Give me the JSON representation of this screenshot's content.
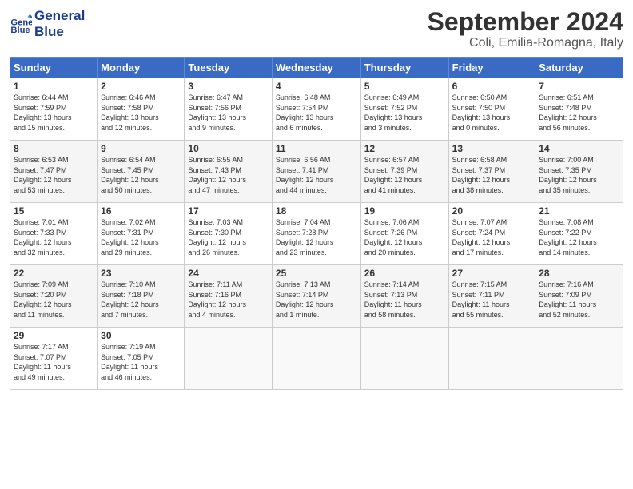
{
  "header": {
    "logo_line1": "General",
    "logo_line2": "Blue",
    "month": "September 2024",
    "location": "Coli, Emilia-Romagna, Italy"
  },
  "columns": [
    "Sunday",
    "Monday",
    "Tuesday",
    "Wednesday",
    "Thursday",
    "Friday",
    "Saturday"
  ],
  "weeks": [
    [
      {
        "day": "1",
        "info": "Sunrise: 6:44 AM\nSunset: 7:59 PM\nDaylight: 13 hours\nand 15 minutes."
      },
      {
        "day": "2",
        "info": "Sunrise: 6:46 AM\nSunset: 7:58 PM\nDaylight: 13 hours\nand 12 minutes."
      },
      {
        "day": "3",
        "info": "Sunrise: 6:47 AM\nSunset: 7:56 PM\nDaylight: 13 hours\nand 9 minutes."
      },
      {
        "day": "4",
        "info": "Sunrise: 6:48 AM\nSunset: 7:54 PM\nDaylight: 13 hours\nand 6 minutes."
      },
      {
        "day": "5",
        "info": "Sunrise: 6:49 AM\nSunset: 7:52 PM\nDaylight: 13 hours\nand 3 minutes."
      },
      {
        "day": "6",
        "info": "Sunrise: 6:50 AM\nSunset: 7:50 PM\nDaylight: 13 hours\nand 0 minutes."
      },
      {
        "day": "7",
        "info": "Sunrise: 6:51 AM\nSunset: 7:48 PM\nDaylight: 12 hours\nand 56 minutes."
      }
    ],
    [
      {
        "day": "8",
        "info": "Sunrise: 6:53 AM\nSunset: 7:47 PM\nDaylight: 12 hours\nand 53 minutes."
      },
      {
        "day": "9",
        "info": "Sunrise: 6:54 AM\nSunset: 7:45 PM\nDaylight: 12 hours\nand 50 minutes."
      },
      {
        "day": "10",
        "info": "Sunrise: 6:55 AM\nSunset: 7:43 PM\nDaylight: 12 hours\nand 47 minutes."
      },
      {
        "day": "11",
        "info": "Sunrise: 6:56 AM\nSunset: 7:41 PM\nDaylight: 12 hours\nand 44 minutes."
      },
      {
        "day": "12",
        "info": "Sunrise: 6:57 AM\nSunset: 7:39 PM\nDaylight: 12 hours\nand 41 minutes."
      },
      {
        "day": "13",
        "info": "Sunrise: 6:58 AM\nSunset: 7:37 PM\nDaylight: 12 hours\nand 38 minutes."
      },
      {
        "day": "14",
        "info": "Sunrise: 7:00 AM\nSunset: 7:35 PM\nDaylight: 12 hours\nand 35 minutes."
      }
    ],
    [
      {
        "day": "15",
        "info": "Sunrise: 7:01 AM\nSunset: 7:33 PM\nDaylight: 12 hours\nand 32 minutes."
      },
      {
        "day": "16",
        "info": "Sunrise: 7:02 AM\nSunset: 7:31 PM\nDaylight: 12 hours\nand 29 minutes."
      },
      {
        "day": "17",
        "info": "Sunrise: 7:03 AM\nSunset: 7:30 PM\nDaylight: 12 hours\nand 26 minutes."
      },
      {
        "day": "18",
        "info": "Sunrise: 7:04 AM\nSunset: 7:28 PM\nDaylight: 12 hours\nand 23 minutes."
      },
      {
        "day": "19",
        "info": "Sunrise: 7:06 AM\nSunset: 7:26 PM\nDaylight: 12 hours\nand 20 minutes."
      },
      {
        "day": "20",
        "info": "Sunrise: 7:07 AM\nSunset: 7:24 PM\nDaylight: 12 hours\nand 17 minutes."
      },
      {
        "day": "21",
        "info": "Sunrise: 7:08 AM\nSunset: 7:22 PM\nDaylight: 12 hours\nand 14 minutes."
      }
    ],
    [
      {
        "day": "22",
        "info": "Sunrise: 7:09 AM\nSunset: 7:20 PM\nDaylight: 12 hours\nand 11 minutes."
      },
      {
        "day": "23",
        "info": "Sunrise: 7:10 AM\nSunset: 7:18 PM\nDaylight: 12 hours\nand 7 minutes."
      },
      {
        "day": "24",
        "info": "Sunrise: 7:11 AM\nSunset: 7:16 PM\nDaylight: 12 hours\nand 4 minutes."
      },
      {
        "day": "25",
        "info": "Sunrise: 7:13 AM\nSunset: 7:14 PM\nDaylight: 12 hours\nand 1 minute."
      },
      {
        "day": "26",
        "info": "Sunrise: 7:14 AM\nSunset: 7:13 PM\nDaylight: 11 hours\nand 58 minutes."
      },
      {
        "day": "27",
        "info": "Sunrise: 7:15 AM\nSunset: 7:11 PM\nDaylight: 11 hours\nand 55 minutes."
      },
      {
        "day": "28",
        "info": "Sunrise: 7:16 AM\nSunset: 7:09 PM\nDaylight: 11 hours\nand 52 minutes."
      }
    ],
    [
      {
        "day": "29",
        "info": "Sunrise: 7:17 AM\nSunset: 7:07 PM\nDaylight: 11 hours\nand 49 minutes."
      },
      {
        "day": "30",
        "info": "Sunrise: 7:19 AM\nSunset: 7:05 PM\nDaylight: 11 hours\nand 46 minutes."
      },
      {
        "day": "",
        "info": ""
      },
      {
        "day": "",
        "info": ""
      },
      {
        "day": "",
        "info": ""
      },
      {
        "day": "",
        "info": ""
      },
      {
        "day": "",
        "info": ""
      }
    ]
  ]
}
